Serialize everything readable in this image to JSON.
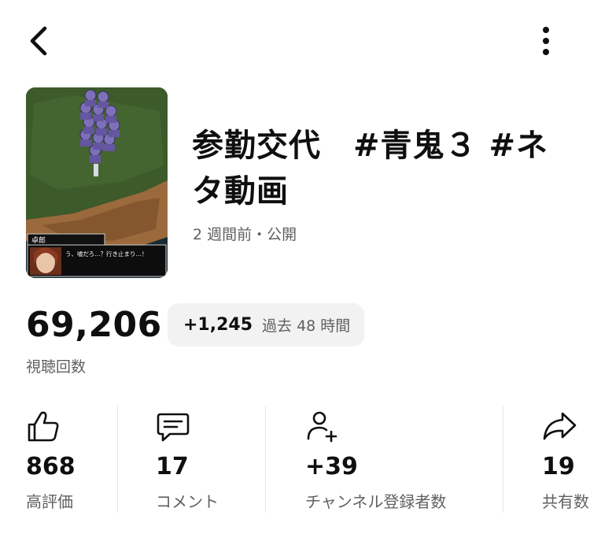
{
  "header": {
    "back_icon": "chevron-left-icon",
    "more_icon": "more-vert-icon"
  },
  "video": {
    "title": "参勤交代　#青鬼３ #ネタ動画",
    "meta": "2 週間前・公開",
    "thumbnail": {
      "speaker": "卓郎",
      "dialogue": "う、嘘だろ…？行き止まり…！"
    }
  },
  "views": {
    "count": "69,206",
    "label": "視聴回数",
    "delta": "+1,245",
    "delta_period": "過去 48 時間"
  },
  "stats": [
    {
      "icon": "thumbs-up-icon",
      "value": "868",
      "label": "高評価"
    },
    {
      "icon": "comment-icon",
      "value": "17",
      "label": "コメント"
    },
    {
      "icon": "add-person-icon",
      "value": "+39",
      "label": "チャンネル登録者数"
    },
    {
      "icon": "share-icon",
      "value": "19",
      "label": "共有数"
    }
  ]
}
